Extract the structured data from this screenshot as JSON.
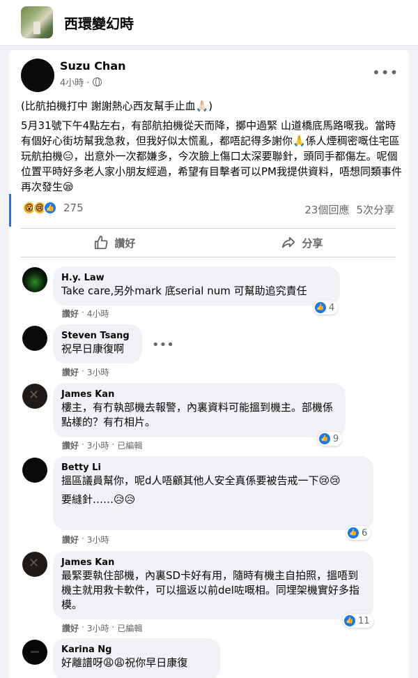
{
  "group": {
    "name": "西環變幻時"
  },
  "post": {
    "author": "Suzu Chan",
    "time": "4小時 · ",
    "caption": "(比航拍機打中 謝謝熱心西友幫手止血🙏🏻)",
    "body": "5月31號下午4點左右，有部航拍機從天而降，擲中過緊 山道橋底馬路嘅我。當時有個好心街坊幫我急救，但我好似太慌亂，都唔記得多謝你🙏係人煙稠密嘅住宅區玩航拍機😑，出意外一次都嫌多，今次臉上傷口太深要聯針，頭同手都傷左。呢個位置平時好多老人家小朋友經過，希望有目擊者可以PM我提供資料，唔想同類事件再次發生😪",
    "reaction_count": "275",
    "comments_count": "23個回應",
    "shares_count": "5次分享"
  },
  "actions": {
    "like": "讚好",
    "share": "分享"
  },
  "comments": [
    {
      "name": "H.y. Law",
      "text": [
        "Take care,另外mark 底serial num 可幫助追究責任"
      ],
      "like": "讚好",
      "time": "4小時",
      "edited": "",
      "likes": "4"
    },
    {
      "name": "Steven Tsang",
      "text": [
        "祝早日康復啊"
      ],
      "like": "讚好",
      "time": "3小時",
      "edited": "",
      "likes": ""
    },
    {
      "name": "James Kan",
      "text": [
        "樓主，有冇執部機去報警，內裏資料可能搵到機主。部機係點樣的？有冇相片。"
      ],
      "like": "讚好",
      "time": "3小時",
      "edited": "已編輯",
      "likes": "9"
    },
    {
      "name": "Betty Li",
      "text": [
        "搵區議員幫你，呢d人唔顧其他人安全真係要被告戒一下😢😢",
        "要縫針……😥😥"
      ],
      "like": "讚好",
      "time": "3小時",
      "edited": "",
      "likes": "6"
    },
    {
      "name": "James Kan",
      "text": [
        "最緊要執住部機，內裏SD卡好有用，隨時有機主自拍照，搵唔到機主就用救卡軟件，可以搵返以前del咗嘅相。同埋架機實好多指模。"
      ],
      "like": "讚好",
      "time": "3小時",
      "edited": "已編輯",
      "likes": "11"
    },
    {
      "name": "Karina Ng",
      "text": [
        "好離譜呀😩😩祝你早日康復"
      ],
      "like": "",
      "time": "",
      "edited": "",
      "likes": ""
    }
  ],
  "icons": {
    "more": "more-horizontal-icon",
    "globe": "globe-icon",
    "like": "thumbs-up-icon",
    "share": "share-arrow-icon"
  },
  "colors": {
    "accent": "#1877f2",
    "secondary_text": "#65676b",
    "bubble": "#f0f2f5"
  }
}
